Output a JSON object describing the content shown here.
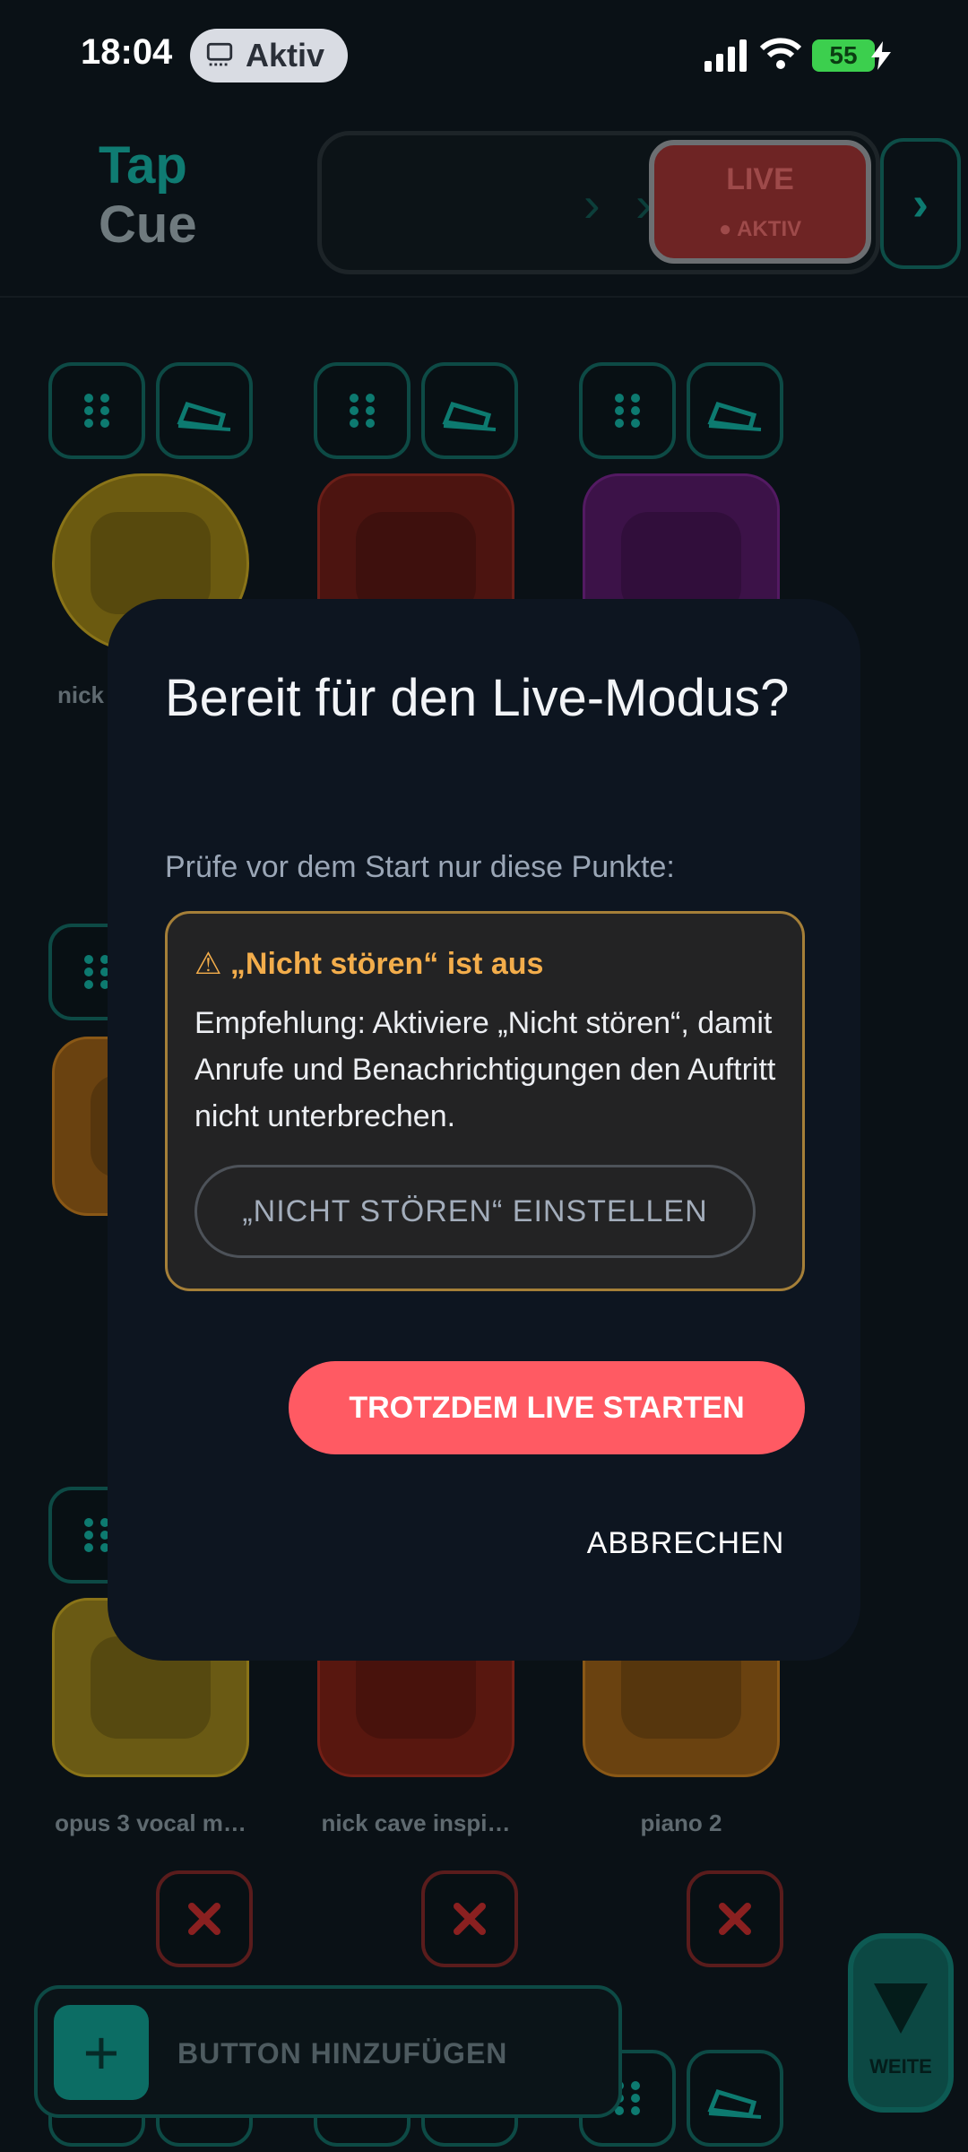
{
  "status": {
    "time": "18:04",
    "pill_label": "Aktiv",
    "battery": "55"
  },
  "app": {
    "logo_line1": "Tap",
    "logo_line2": "Cue",
    "live_label": "LIVE",
    "live_sub": "● AKTIV",
    "next_chevron": "›"
  },
  "pads": [
    {
      "label": "nick",
      "color": "#6b5a10"
    },
    {
      "label": "",
      "color": "#4c1410"
    },
    {
      "label": "",
      "color": "#3c1248"
    },
    {
      "label": "opus 3 vocal m…",
      "color": "#6a5a14"
    },
    {
      "label": "nick cave inspi…",
      "color": "#58170f"
    },
    {
      "label": "piano 2",
      "color": "#6a4210"
    }
  ],
  "addbar": {
    "plus": "+",
    "label": "BUTTON HINZUFÜGEN"
  },
  "weiter": {
    "label": "WEITE"
  },
  "dialog": {
    "title": "Bereit für den Live-Modus?",
    "subtitle": "Prüfe vor dem Start nur diese Punkte:",
    "warning_title": "⚠ „Nicht stören“ ist aus",
    "warning_body": "Empfehlung: Aktiviere „Nicht stören“, damit Anrufe und Benachrichtigungen den Auftritt nicht unterbrechen.",
    "settings_button": "„NICHT STÖREN“ EINSTELLEN",
    "start_button": "TROTZDEM LIVE STARTEN",
    "cancel_button": "ABBRECHEN"
  },
  "colors": {
    "accent_teal": "#0d4a45",
    "danger": "#ff5a63",
    "warning": "#f3ad4b"
  }
}
